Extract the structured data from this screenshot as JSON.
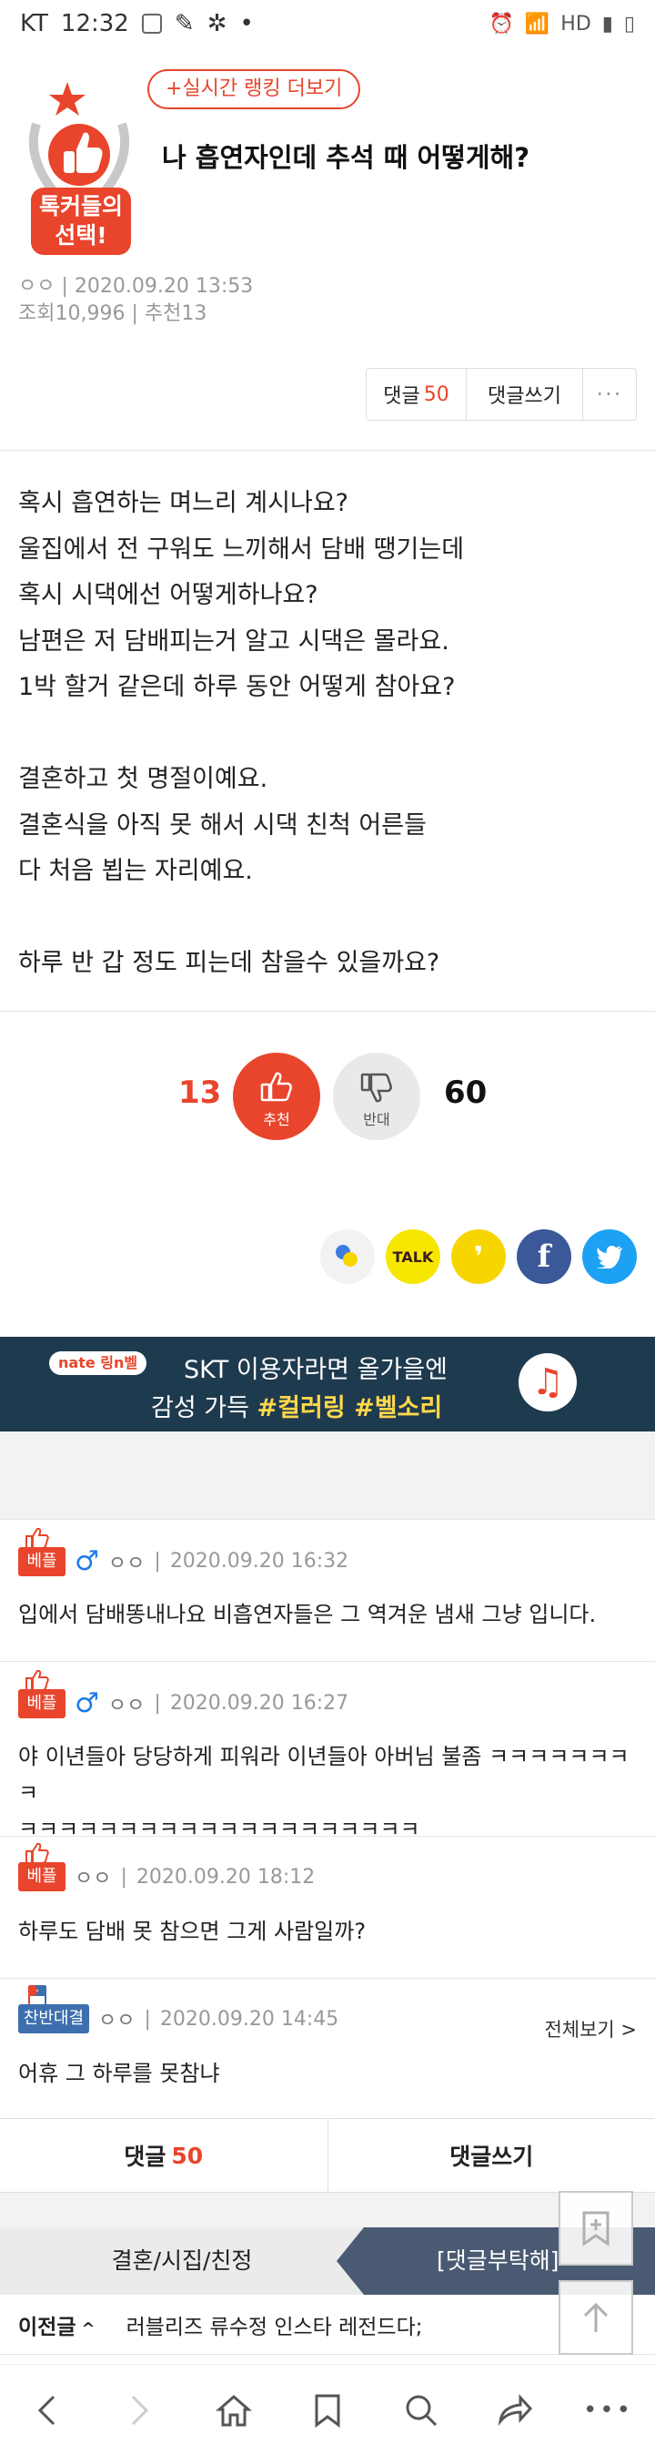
{
  "status_bar": {
    "carrier": "KT",
    "time": "12:32"
  },
  "header": {
    "badge_text": "톡커들의 선택!",
    "ranking_button": "+실시간 랭킹 더보기",
    "title": "나 흡연자인데 추석 때 어떻게해?"
  },
  "meta": {
    "author": "ㅇㅇ",
    "date": "2020.09.20 13:53",
    "views_label": "조회",
    "views": "10,996",
    "recommend_label": "추천",
    "recommend": "13"
  },
  "toolbar": {
    "comment_label": "댓글",
    "comment_count": "50",
    "write_label": "댓글쓰기",
    "more_label": "···"
  },
  "body_lines": [
    "혹시 흡연하는 며느리 계시나요?",
    "울집에서 전 구워도 느끼해서 담배 땡기는데",
    "혹시 시댁에선 어떻게하나요?",
    "남편은 저 담배피는거 알고 시댁은 몰라요.",
    "1박 할거 같은데 하루 동안 어떻게 참아요?",
    "",
    "결혼하고 첫 명절이예요.",
    "결혼식을 아직 못 해서 시댁 친척 어른들",
    "다 처음 뵙는 자리예요.",
    "",
    "하루 반 갑 정도 피는데 참을수 있을까요?"
  ],
  "votes": {
    "up_count": "13",
    "up_label": "추천",
    "down_label": "반대",
    "down_count": "60"
  },
  "share": {
    "kakao_label": "TALK",
    "facebook_label": "f"
  },
  "banner": {
    "brand": "nate 링n벨",
    "line1": "SKT 이용자라면 올가을엔",
    "line2_prefix": "감성 가득 ",
    "line2_highlight": "#컬러링 #벨소리"
  },
  "comments": [
    {
      "badge": "베플",
      "gender": "♂",
      "name": "ㅇㅇ",
      "date": "2020.09.20 16:32",
      "lines": [
        "입에서 담배똥내나요 비흡연자들은 그 역겨운 냄새 그냥 입니다."
      ]
    },
    {
      "badge": "베플",
      "gender": "♂",
      "name": "ㅇㅇ",
      "date": "2020.09.20 16:27",
      "lines": [
        "야 이년들아 당당하게 피워라 이년들아 아버님 불좀 ㅋㅋㅋㅋㅋㅋㅋㅋ",
        "ㅋㅋㅋㅋㅋㅋㅋㅋㅋㅋㅋㅋㅋㅋㅋㅋㅋㅋㅋㅋ"
      ]
    },
    {
      "badge": "베플",
      "gender": "",
      "name": "ㅇㅇ",
      "date": "2020.09.20 18:12",
      "lines": [
        "하루도 담배 못 참으면 그게 사람일까?"
      ]
    },
    {
      "badge": "찬반대결",
      "gender": "",
      "name": "ㅇㅇ",
      "date": "2020.09.20 14:45",
      "more": "전체보기 >",
      "lines": [
        "어휴 그 하루를 못참냐"
      ]
    }
  ],
  "bottom": {
    "comment_label": "댓글",
    "comment_count": "50",
    "write_label": "댓글쓰기"
  },
  "tabs": {
    "category": "결혼/시집/친정",
    "request": "[댓글부탁해]"
  },
  "prev": {
    "label": "이전글",
    "arrow": "^",
    "title": "러블리즈 류수정 인스타 레전드다;"
  }
}
